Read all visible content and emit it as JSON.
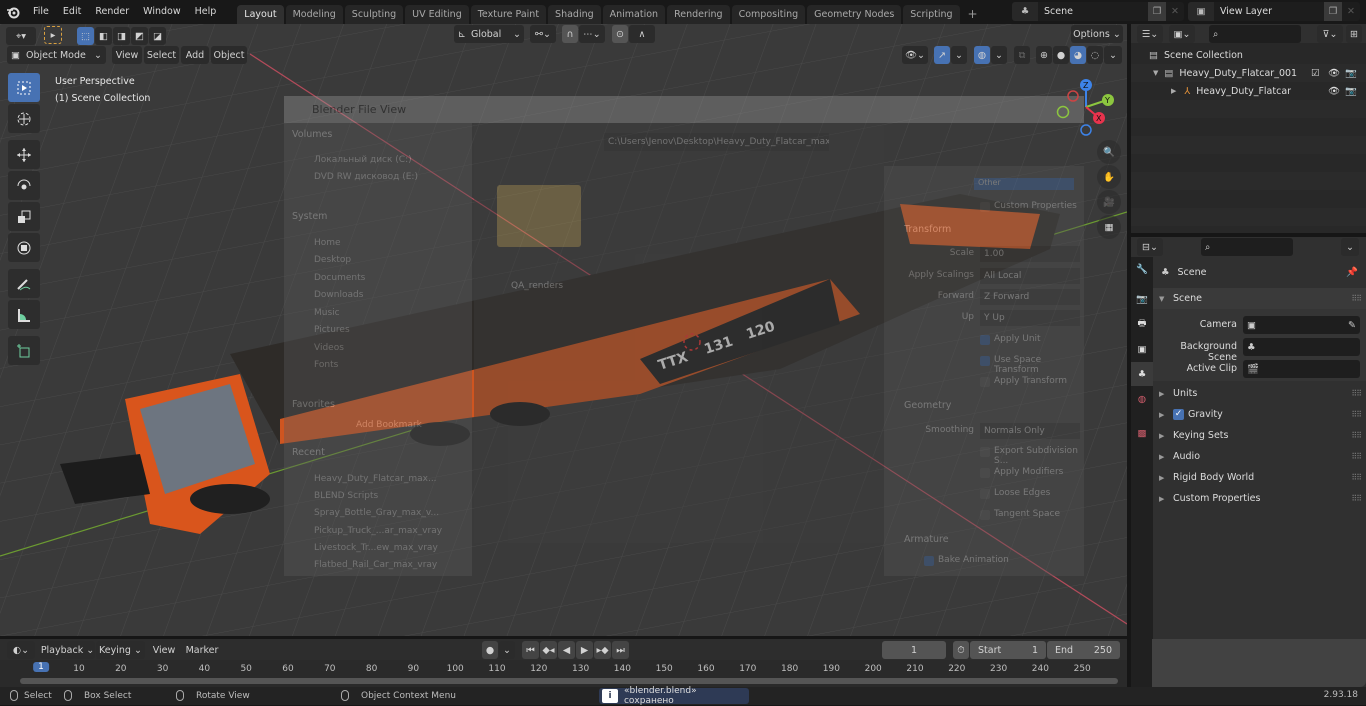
{
  "topbar": {
    "menus": [
      "File",
      "Edit",
      "Render",
      "Window",
      "Help"
    ],
    "workspaces": [
      "Layout",
      "Modeling",
      "Sculpting",
      "UV Editing",
      "Texture Paint",
      "Shading",
      "Animation",
      "Rendering",
      "Compositing",
      "Geometry Nodes",
      "Scripting"
    ],
    "active_workspace": "Layout",
    "add_tab": "+",
    "scene_name": "Scene",
    "view_layer_name": "View Layer"
  },
  "viewport_header": {
    "mode": "Object Mode",
    "menus": [
      "View",
      "Select",
      "Add",
      "Object"
    ],
    "orientation": "Global",
    "options_label": "Options"
  },
  "viewport": {
    "view_label": "User Perspective",
    "collection_label": "(1) Scene Collection",
    "gizmo_axes": [
      "X",
      "Y",
      "Z"
    ],
    "tools": [
      "select-box",
      "cursor",
      "move",
      "rotate",
      "scale",
      "transform",
      "annotate",
      "measure",
      "add-cube"
    ],
    "nav_buttons": [
      "zoom",
      "pan",
      "camera",
      "ortho-toggle"
    ],
    "model_text": [
      "TTX",
      "131",
      "120"
    ]
  },
  "file_view": {
    "title": "Blender File View",
    "path": "C:\\Users\\Jenov\\Desktop\\Heavy_Duty_Flatcar_max_vray\\",
    "sections": {
      "volumes": {
        "label": "Volumes",
        "items": [
          "Локальный диск (C:)",
          "DVD RW дисковод (E:)"
        ]
      },
      "system": {
        "label": "System",
        "items": [
          "Home",
          "Desktop",
          "Documents",
          "Downloads",
          "Music",
          "Pictures",
          "Videos",
          "Fonts"
        ]
      },
      "favorites": {
        "label": "Favorites",
        "items": [
          "Add Bookmark"
        ]
      },
      "recent": {
        "label": "Recent",
        "items": [
          "Heavy_Duty_Flatcar_max...",
          "BLEND Scripts",
          "Spray_Bottle_Gray_max_v...",
          "Pickup_Truck_...ar_max_vray",
          "Livestock_Tr...ew_max_vray",
          "Flatbed_Rail_Car_max_vray"
        ]
      }
    },
    "folder_name": "QA_renders",
    "export_options": {
      "owner_label": "Other",
      "custom_properties": "Custom Properties",
      "transform_label": "Transform",
      "scale_label": "Scale",
      "scale_value": "1.00",
      "apply_scalings_label": "Apply Scalings",
      "apply_scalings_value": "All Local",
      "forward_label": "Forward",
      "forward_value": "Z Forward",
      "up_label": "Up",
      "up_value": "Y Up",
      "apply_unit": "Apply Unit",
      "use_space_transform": "Use Space Transform",
      "apply_transform": "Apply Transform",
      "geometry_label": "Geometry",
      "smoothing_label": "Smoothing",
      "smoothing_value": "Normals Only",
      "export_subdiv": "Export Subdivision S...",
      "apply_modifiers": "Apply Modifiers",
      "loose_edges": "Loose Edges",
      "tangent_space": "Tangent Space",
      "armature_label": "Armature",
      "bake_animation": "Bake Animation"
    }
  },
  "outliner": {
    "root": "Scene Collection",
    "items": [
      {
        "name": "Heavy_Duty_Flatcar_001",
        "type": "collection",
        "expanded": true,
        "checked": true
      },
      {
        "name": "Heavy_Duty_Flatcar",
        "type": "empty",
        "expanded": false
      }
    ]
  },
  "properties": {
    "context_label": "Scene",
    "panel_title": "Scene",
    "fields": [
      {
        "label": "Camera",
        "value": ""
      },
      {
        "label": "Background Scene",
        "value": ""
      },
      {
        "label": "Active Clip",
        "value": ""
      }
    ],
    "collapsed_panels": [
      "Units",
      "Gravity",
      "Keying Sets",
      "Audio",
      "Rigid Body World",
      "Custom Properties"
    ],
    "gravity_enabled": true
  },
  "timeline": {
    "menus": [
      "Playback",
      "Keying",
      "View",
      "Marker"
    ],
    "current_frame": "1",
    "start_label": "Start",
    "start": "1",
    "end_label": "End",
    "end": "250",
    "ruler_ticks": [
      "1",
      "10",
      "20",
      "30",
      "40",
      "50",
      "60",
      "70",
      "80",
      "90",
      "100",
      "110",
      "120",
      "130",
      "140",
      "150",
      "160",
      "170",
      "180",
      "190",
      "200",
      "210",
      "220",
      "230",
      "240",
      "250"
    ]
  },
  "statusbar": {
    "select": "Select",
    "box_select": "Box Select",
    "rotate_view": "Rotate View",
    "context_menu": "Object Context Menu",
    "message": "«blender.blend» сохранено",
    "version": "2.93.18"
  },
  "colors": {
    "accent": "#4772b3",
    "axis_x": "#e8334d",
    "axis_y": "#8cc63f",
    "axis_z": "#3d83e8",
    "model_orange": "#d9551c"
  }
}
